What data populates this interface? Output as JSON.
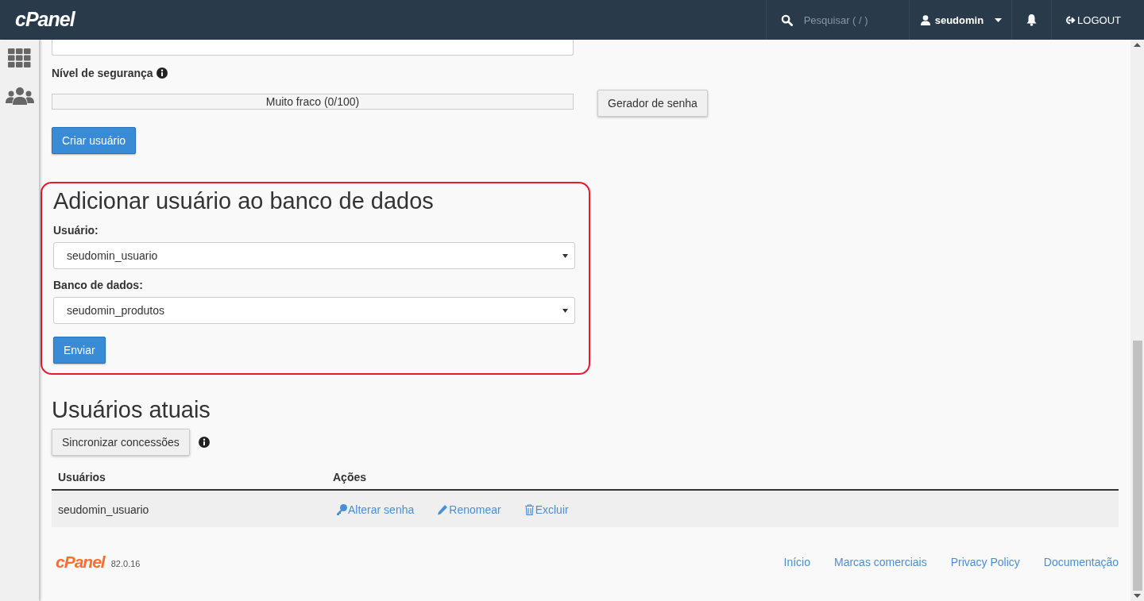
{
  "header": {
    "logo": "cPanel",
    "search": {
      "placeholder": "Pesquisar ( / )"
    },
    "user": "seudomin",
    "logout": "LOGOUT"
  },
  "sidebar": {
    "items": [
      {
        "kind": "grid"
      },
      {
        "kind": "users"
      }
    ]
  },
  "strength": {
    "label": "Nível de segurança",
    "reading": "Muito fraco (0/100)",
    "level": 0,
    "generator": "Gerador de senha",
    "create": "Criar usuário"
  },
  "add_user": {
    "title": "Adicionar usuário ao banco de dados",
    "user_label": "Usuário:",
    "user_value": "seudomin_usuario",
    "db_label": "Banco de dados:",
    "db_value": "seudomin_produtos",
    "submit": "Enviar"
  },
  "current": {
    "title": "Usuários atuais",
    "sync": "Sincronizar concessões",
    "columns": [
      "Usuários",
      "Ações"
    ],
    "rows": [
      {
        "user": "seudomin_usuario",
        "actions": [
          {
            "kind": "key",
            "label": "Alterar senha"
          },
          {
            "kind": "pencil",
            "label": "Renomear"
          },
          {
            "kind": "trash",
            "label": "Excluir"
          }
        ]
      }
    ]
  },
  "footer": {
    "logo": "cPanel",
    "version": "82.0.16",
    "links": [
      "Início",
      "Marcas comerciais",
      "Privacy Policy",
      "Documentação"
    ]
  }
}
